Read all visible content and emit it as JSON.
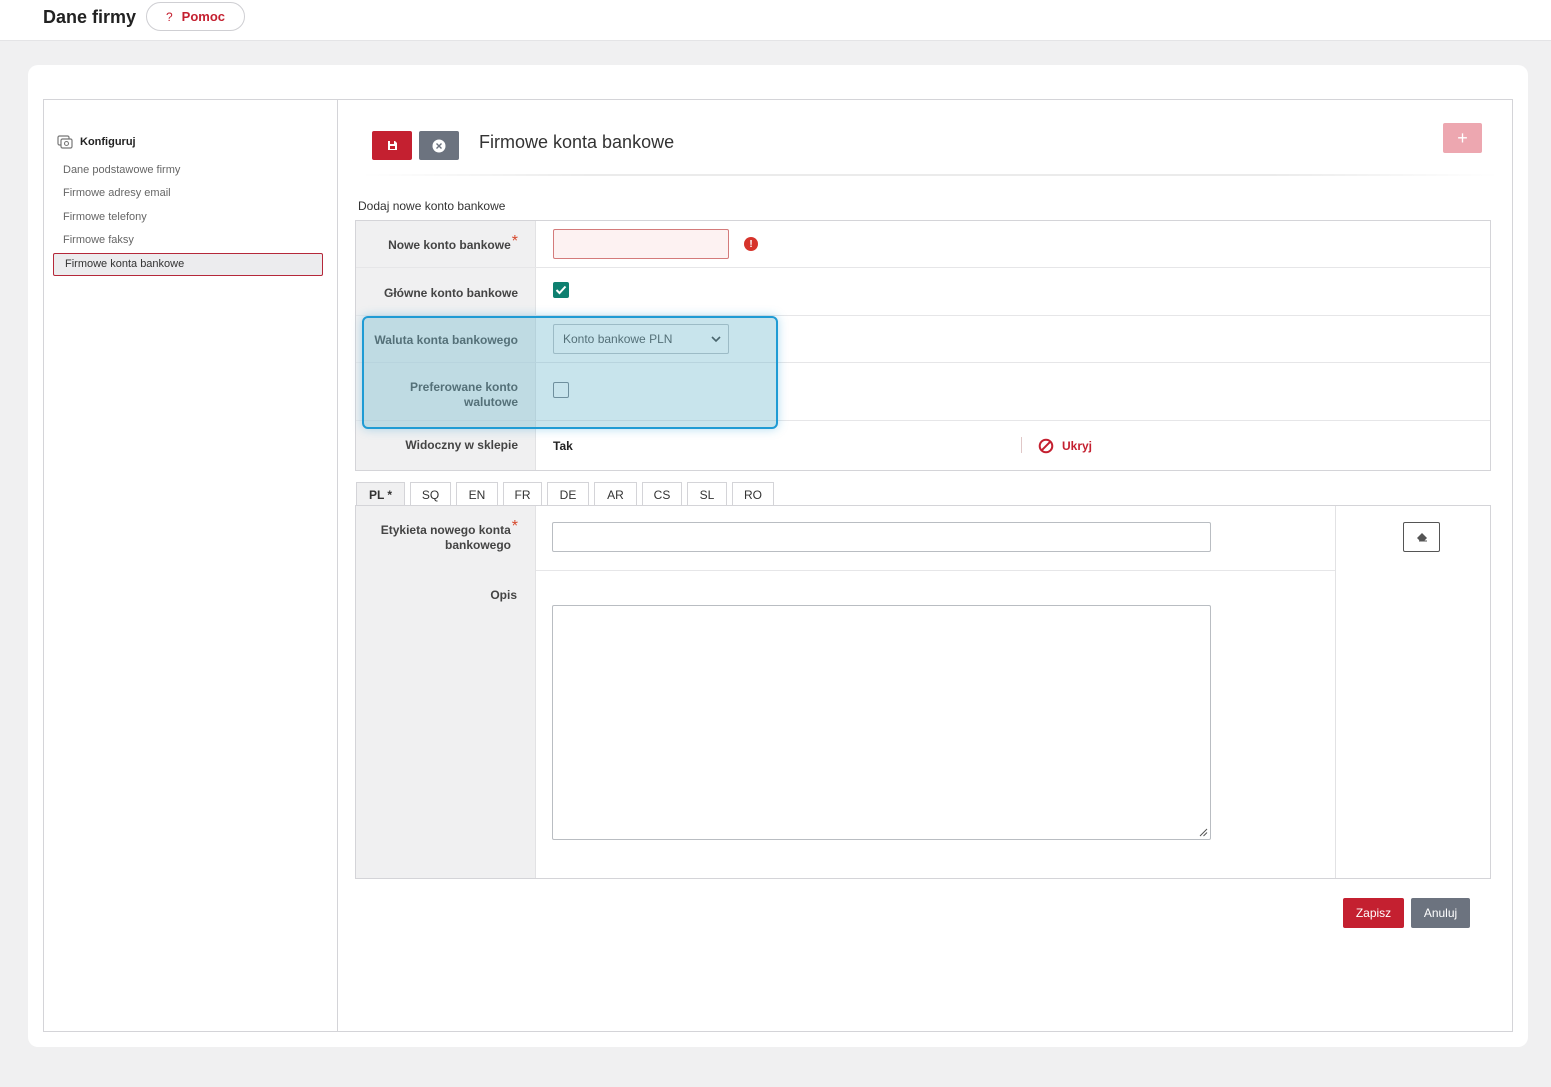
{
  "header": {
    "title": "Dane firmy",
    "help_label": "Pomoc"
  },
  "sidebar": {
    "heading": "Konfiguruj",
    "items": [
      {
        "label": "Dane podstawowe firmy"
      },
      {
        "label": "Firmowe adresy email"
      },
      {
        "label": "Firmowe telefony"
      },
      {
        "label": "Firmowe faksy"
      },
      {
        "label": "Firmowe konta bankowe",
        "active": true
      }
    ]
  },
  "section": {
    "title": "Firmowe konta bankowe",
    "add_label": "+"
  },
  "form": {
    "subheading": "Dodaj nowe konto bankowe",
    "new_account": {
      "label": "Nowe konto bankowe",
      "value": ""
    },
    "main_account": {
      "label": "Główne konto bankowe",
      "checked": true
    },
    "currency": {
      "label": "Waluta konta bankowego",
      "selected": "Konto bankowe PLN"
    },
    "preferred": {
      "label_line1": "Preferowane konto",
      "label_line2": "walutowe",
      "checked": false
    },
    "visible": {
      "label": "Widoczny w sklepie",
      "value": "Tak",
      "hide_label": "Ukryj"
    }
  },
  "tabs": [
    {
      "label": "PL *",
      "active": true
    },
    {
      "label": "SQ"
    },
    {
      "label": "EN"
    },
    {
      "label": "FR"
    },
    {
      "label": "DE"
    },
    {
      "label": "AR"
    },
    {
      "label": "CS"
    },
    {
      "label": "SL"
    },
    {
      "label": "RO"
    }
  ],
  "lang_form": {
    "label_field": {
      "label_line1": "Etykieta nowego konta",
      "label_line2": "bankowego",
      "value": ""
    },
    "description": {
      "label": "Opis",
      "value": ""
    }
  },
  "footer": {
    "save_label": "Zapisz",
    "cancel_label": "Anuluj"
  },
  "colors": {
    "primary": "#c42030",
    "secondary": "#6c737f",
    "accent_check": "#0e8070",
    "highlight": "#1f9bd4"
  },
  "icons": {
    "save": "floppy-disk-icon",
    "close": "circle-x-icon",
    "error": "exclamation-circle-icon",
    "hide": "prohibited-icon",
    "erase": "eraser-icon",
    "config": "gears-icon"
  }
}
